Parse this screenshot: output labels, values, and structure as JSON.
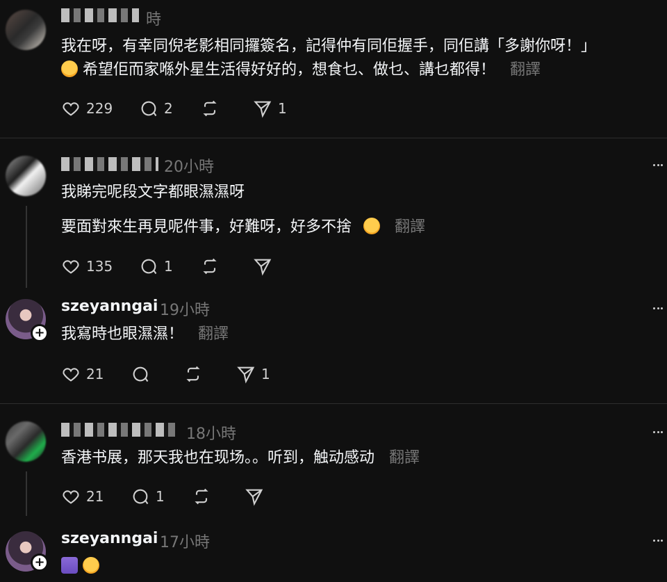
{
  "comments": [
    {
      "author_time": "時",
      "lines": [
        "我在呀，有幸同倪老影相同攞簽名，記得仲有同佢握手，同佢講「多謝你呀！」",
        "希望佢而家喺外星生活得好好的，想食乜、做乜、講乜都得！"
      ],
      "translate": "翻譯",
      "likes": "229",
      "replies": "2",
      "reposts": "",
      "shares": "1"
    },
    {
      "author_time": "20小時",
      "lines": [
        "我睇完呢段文字都眼濕濕呀",
        "要面對來生再見呢件事，好難呀，好多不捨"
      ],
      "translate": "翻譯",
      "likes": "135",
      "replies": "1",
      "reposts": "",
      "shares": ""
    },
    {
      "author": "szeyanngai",
      "author_time": "19小時",
      "lines": [
        "我寫時也眼濕濕！"
      ],
      "translate": "翻譯",
      "likes": "21",
      "replies": "",
      "reposts": "",
      "shares": "1"
    },
    {
      "author_time": "18小時",
      "lines": [
        "香港书展，那天我也在现场。。听到，触动感动"
      ],
      "translate": "翻譯",
      "likes": "21",
      "replies": "1",
      "reposts": "",
      "shares": ""
    },
    {
      "author": "szeyanngai",
      "author_time": "17小時",
      "lines": [
        ""
      ]
    }
  ],
  "icons": [
    "heart-icon",
    "comment-icon",
    "repost-icon",
    "share-icon",
    "more-icon",
    "follow-plus-icon"
  ],
  "colors": {
    "background": "#101010",
    "text": "#f3f5f7",
    "muted": "#777777",
    "divider": "#2e2e2e"
  }
}
